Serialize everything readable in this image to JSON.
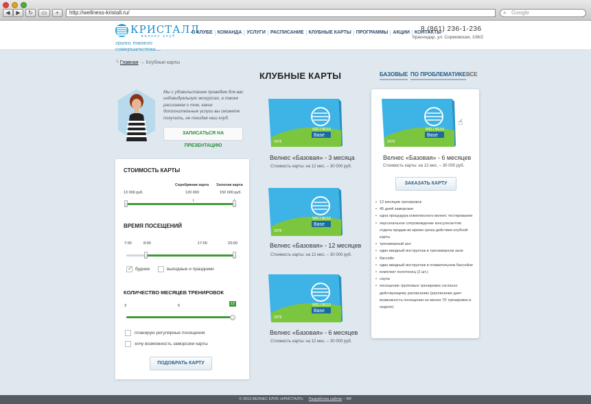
{
  "browser": {
    "url": "http://wellness-kristall.ru/",
    "search_placeholder": "Google"
  },
  "logo": {
    "name": "КРИСТАЛЛ",
    "sub": "велнес клуб",
    "slogan": "грани твоего совершенства..."
  },
  "nav": [
    "О КЛУБЕ",
    "КОМАНДА",
    "УСЛУГИ",
    "РАСПИСАНИЕ",
    "КЛУБНЫЕ КАРТЫ",
    "ПРОГРАММЫ",
    "АКЦИИ",
    "КОНТАКТЫ"
  ],
  "contacts": {
    "phone": "8 (861) 236-1-236",
    "address": "Краснодар, ул. Сормовская, 108/2"
  },
  "breadcrumb": {
    "home": "Главная",
    "separator": "→",
    "current": "Клубные карты"
  },
  "page_title": "КЛУБНЫЕ КАРТЫ",
  "filter_tabs": [
    "БАЗОВЫЕ",
    "ПО ПРОБЛЕМАТИКЕ",
    "ВСЕ"
  ],
  "promo": {
    "text": "Мы с удовольствием проведем для вас индивидуальную экскурсию, а также расскажем о том, какие дополнительные услуги вы сможете получить, не покидая наш клуб.",
    "button": "ЗАПИСАТЬСЯ НА ПРЕЗЕНТАЦИЮ"
  },
  "filter": {
    "cost": {
      "title": "СТОИМОСТЬ КАРТЫ",
      "min_value": "13 000 руб.",
      "silver_label": "Серебряная карта",
      "gold_label": "Золотая карта",
      "silver_value": "120 000",
      "gold_value": "150 000 руб.",
      "range_selected": [
        0,
        1
      ]
    },
    "time": {
      "title": "ВРЕМЯ ПОСЕЩЕНИЙ",
      "ticks": [
        "7:00",
        "8:00",
        "17:00",
        "23:00"
      ],
      "range_selected": [
        0.17,
        1
      ],
      "checkbox_weekdays": "будние",
      "checkbox_weekdays_checked": true,
      "checkbox_weekends": "выходные и праздники",
      "checkbox_weekends_checked": false
    },
    "months": {
      "title": "КОЛИЧЕСТВО МЕСЯЦЕВ ТРЕНИРОВОК",
      "ticks": [
        "3",
        "6"
      ],
      "selected": "12",
      "fill_fraction": 1
    },
    "options": [
      {
        "label": "планирую регулярные посещения",
        "checked": false
      },
      {
        "label": "хочу возможность заморозки карты",
        "checked": false
      }
    ],
    "submit": "ПОДОБРАТЬ КАРТУ"
  },
  "card_image_text": {
    "wellness": "WELLNESS",
    "base": "Base",
    "year": "2978"
  },
  "cards": [
    {
      "title": "Велнес «Базовая» - 3 месяца",
      "price": "Стоимость  карты:  на 12 мес. – 30 000 руб."
    },
    {
      "title": "Велнес «Базовая» - 12 месяцев",
      "price": "Стоимость  карты:  на 12 мес. – 30 000 руб."
    },
    {
      "title": "Велнес «Базовая» - 6 месяцев",
      "price": "Стоимость  карты:  на 12 мес. – 30 000 руб."
    }
  ],
  "featured": {
    "title": "Велнес «Базовая» - 6 месяцев",
    "price": "Стоимость  карты:  на 12 мес. – 30 000 руб.",
    "button": "ЗАКАЗАТЬ КАРТУ",
    "features": [
      "12 месяцев тренировок",
      "45 дней заморозки",
      "одна процедура комплексного велнес тестирование",
      "персональное сопровождение консультантом отдела продаж во время срока действия клубной карты",
      "тренажерный зал",
      "один  вводный  инструктаж в тренажерном зале",
      "бассейн",
      "один  вводный  инструктаж в плавательном бассейне",
      "комплект полотенец (2 шт.)",
      "сауна",
      "посещение групповых тренировок согласно действующему расписанию (расписание дает возможность посещения не менее 70 тренировок в неделе)"
    ]
  },
  "footer": {
    "copyright": "© 2013 ВЕЛНЕС КЛУБ «КРИСТАЛЛ»",
    "dev_link": "Разработка сайтов",
    "dev_suffix": "– WF"
  },
  "colors": {
    "accent_green": "#3d9a39",
    "link_blue": "#1d5a80",
    "logo_blue": "#1a88c8",
    "background": "#dfe8ef",
    "footer": "#555c61"
  }
}
